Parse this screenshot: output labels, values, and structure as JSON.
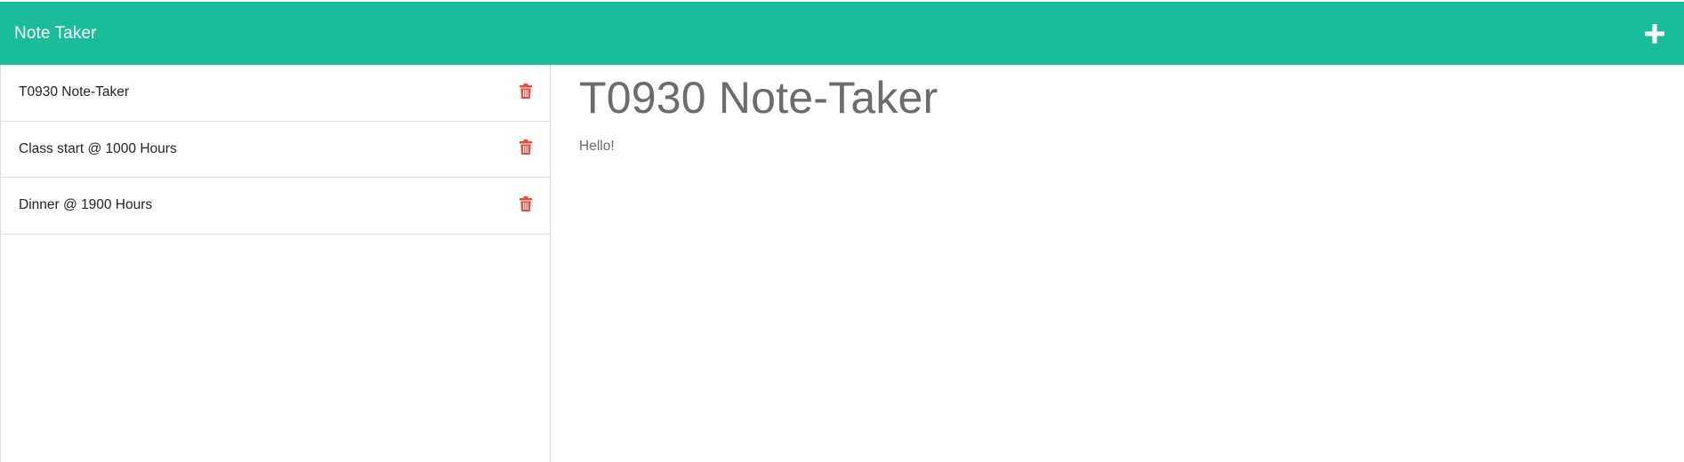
{
  "navbar": {
    "brand": "Note Taker",
    "background_color": "#1abc9c",
    "add_icon": "plus-icon"
  },
  "sidebar": {
    "notes": [
      {
        "title": "T0930 Note-Taker",
        "delete_icon": "trash-icon"
      },
      {
        "title": "Class start @ 1000 Hours",
        "delete_icon": "trash-icon"
      },
      {
        "title": "Dinner @ 1900 Hours",
        "delete_icon": "trash-icon"
      }
    ],
    "delete_icon_color": "#e74c3c"
  },
  "main": {
    "note_title": "T0930 Note-Taker",
    "note_text": "Hello!"
  }
}
